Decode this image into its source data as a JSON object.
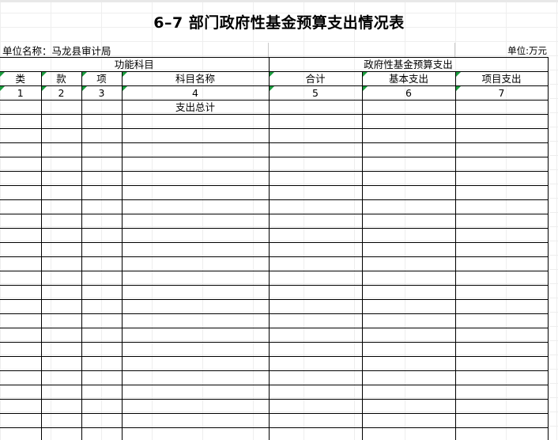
{
  "title": "6–7  部门政府性基金预算支出情况表",
  "unit_name": "单位名称：马龙县审计局",
  "unit_label": "单位:万元",
  "group_headers": {
    "function": "功能科目",
    "fund": "政府性基金预算支出"
  },
  "columns": [
    "类",
    "款",
    "项",
    "科目名称",
    "合计",
    "基本支出",
    "项目支出"
  ],
  "column_numbers": [
    "1",
    "2",
    "3",
    "4",
    "5",
    "6",
    "7"
  ],
  "total_row_label": "支出总计",
  "empty_rows": 23,
  "colors": {
    "cell_marker": "#1a9c3e",
    "border": "#000000",
    "gridline": "#dadada"
  }
}
